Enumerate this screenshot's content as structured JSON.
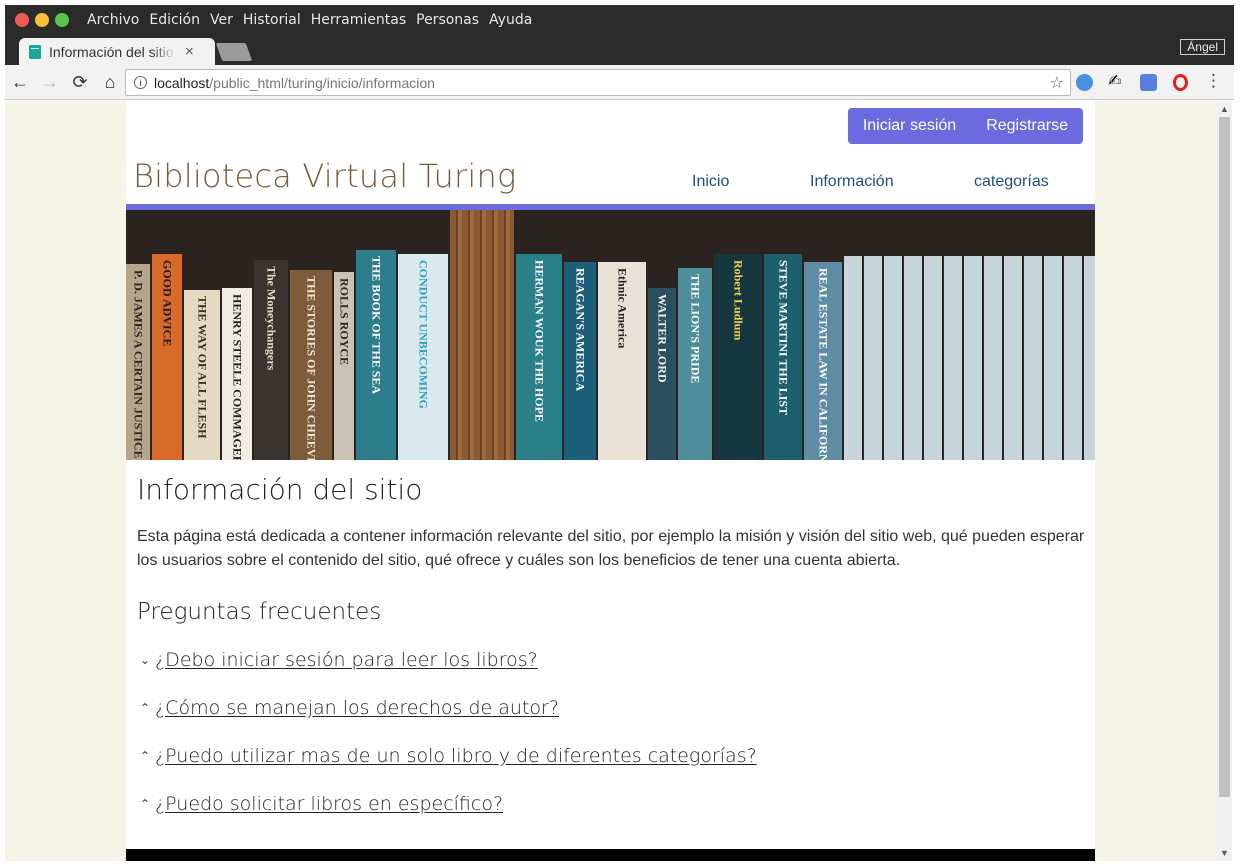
{
  "os": {
    "menu": [
      "Archivo",
      "Edición",
      "Ver",
      "Historial",
      "Herramientas",
      "Personas",
      "Ayuda"
    ]
  },
  "browser": {
    "tab_title": "Información del sitio",
    "tab_close": "×",
    "user": "Ángel",
    "url_host": "localhost",
    "url_path": "/public_html/turing/inicio/informacion",
    "icons": {
      "back": "arrow-left-icon",
      "forward": "arrow-right-icon",
      "reload": "reload-icon",
      "home": "home-icon",
      "info": "info-icon",
      "star": "star-icon",
      "menu": "kebab-icon"
    }
  },
  "site": {
    "title": "Biblioteca Virtual Turing",
    "login": "Iniciar sesión",
    "register": "Registrarse",
    "nav": {
      "home": "Inicio",
      "info": "Información",
      "categories": "categorías"
    },
    "accent_color": "#6b6ade",
    "title_color": "#7a5a38"
  },
  "banner": {
    "books": [
      {
        "title": "P. D. JAMES  A CERTAIN JUSTICE",
        "color": "#b7a58b",
        "text_color": "#2b2320"
      },
      {
        "title": "GOOD ADVICE",
        "color": "#d86a2a",
        "text_color": "#1c1c1c"
      },
      {
        "title": "THE WAY OF ALL FLESH",
        "color": "#e4d9c2",
        "text_color": "#3a2d22"
      },
      {
        "title": "HENRY STEELE COMMAGER",
        "color": "#f0ece4",
        "text_color": "#222"
      },
      {
        "title": "The Moneychangers",
        "color": "#3a3430",
        "text_color": "#e8dcc4"
      },
      {
        "title": "THE STORIES OF JOHN CHEEVER",
        "color": "#7d5c3c",
        "text_color": "#f3e7d3"
      },
      {
        "title": "ROLLS ROYCE",
        "color": "#c9c3b6",
        "text_color": "#2a2a2a"
      },
      {
        "title": "THE BOOK OF THE SEA",
        "color": "#2d7d8a",
        "text_color": "#ffffff"
      },
      {
        "title": "CONDUCT UNBECOMING",
        "color": "#dbe8ec",
        "text_color": "#2aa2c7"
      },
      {
        "title": "HERMAN WOUK THE HOPE",
        "color": "#2a7f88",
        "text_color": "#ffffff"
      },
      {
        "title": "REAGAN'S AMERICA",
        "color": "#1d5f7a",
        "text_color": "#ffffff"
      },
      {
        "title": "Ethnic America",
        "color": "#e7e2d5",
        "text_color": "#222"
      },
      {
        "title": "WALTER LORD",
        "color": "#2c4f60",
        "text_color": "#f2f2f2"
      },
      {
        "title": "THE LION'S PRIDE",
        "color": "#4e8e9a",
        "text_color": "#ffffff"
      },
      {
        "title": "Robert Ludlum",
        "color": "#163640",
        "text_color": "#f0d34a"
      },
      {
        "title": "STEVE MARTINI THE LIST",
        "color": "#1e5f6e",
        "text_color": "#ffffff"
      },
      {
        "title": "REAL ESTATE LAW IN CALIFORNIA",
        "color": "#5e8da3",
        "text_color": "#ffffff"
      }
    ]
  },
  "content": {
    "heading": "Información del sitio",
    "intro": "Esta página está dedicada a contener información relevante del sitio, por ejemplo la misión y visión del sitio web, qué pueden esperar los usuarios sobre el contenido del sitio, qué ofrece y cuáles son los beneficios de tener una cuenta abierta.",
    "faq_heading": "Preguntas frecuentes",
    "faq": [
      {
        "question": "¿Debo iniciar sesión para leer los libros?",
        "chevron": "⌄"
      },
      {
        "question": "¿Cómo se manejan los derechos de autor?",
        "chevron": "⌃"
      },
      {
        "question": "¿Puedo utilizar mas de un solo libro y de diferentes categorías?",
        "chevron": "⌃"
      },
      {
        "question": "¿Puedo solicitar libros en específico?",
        "chevron": "⌃"
      }
    ]
  }
}
